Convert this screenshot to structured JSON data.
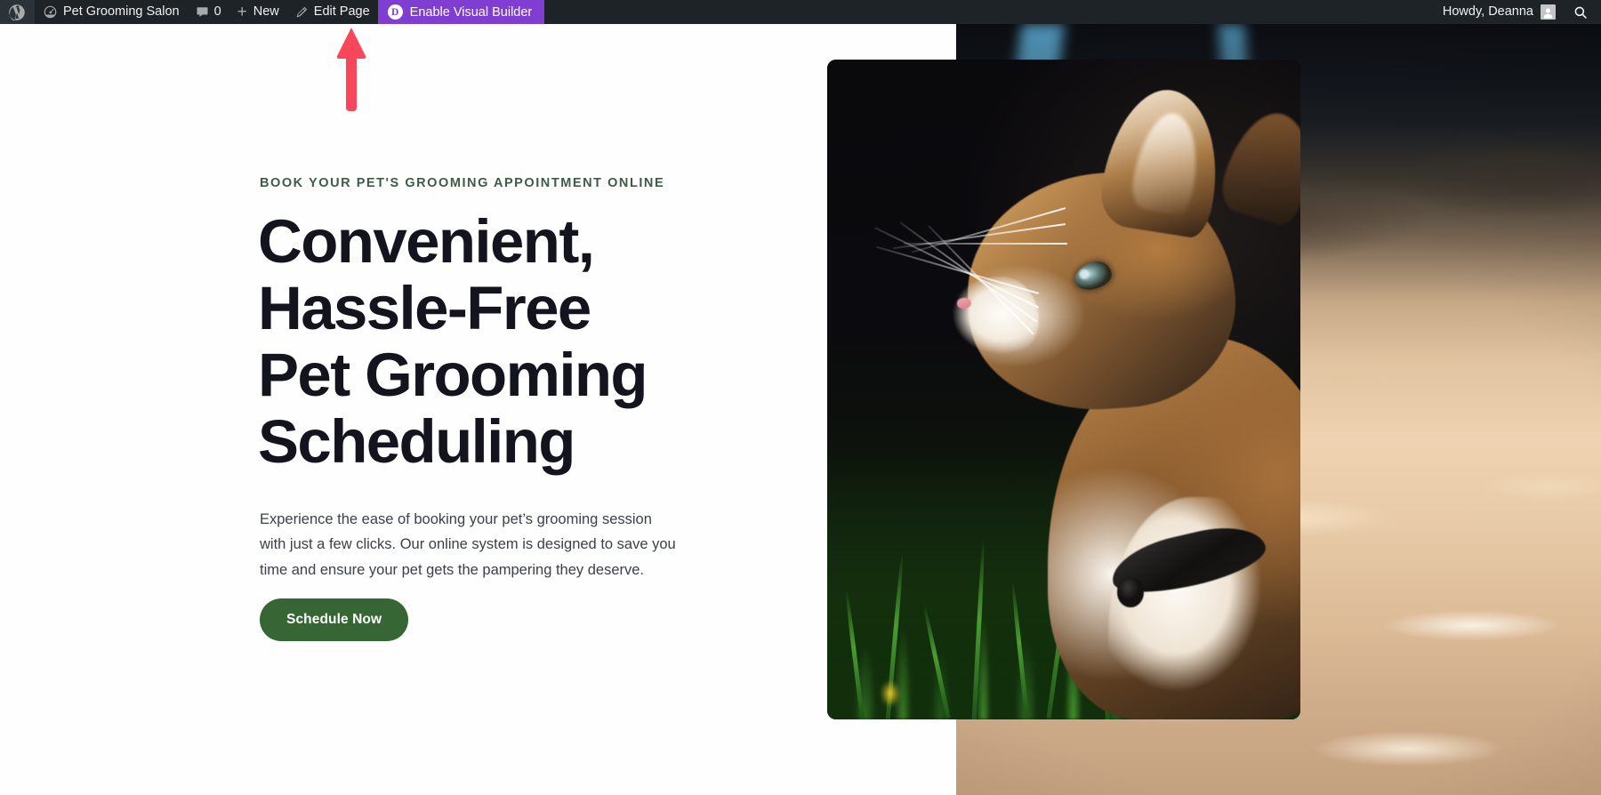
{
  "admin_bar": {
    "wp_logo_icon": "wordpress-logo-icon",
    "site_icon": "dashboard-speedometer-icon",
    "site_name": "Pet Grooming Salon",
    "comments_icon": "comment-bubble-icon",
    "comments_count": "0",
    "new_plus_icon": "plus-icon",
    "new_label": "New",
    "edit_icon": "pencil-icon",
    "edit_label": "Edit Page",
    "divi_badge": "D",
    "divi_label": "Enable Visual Builder",
    "divi_color": "#7f3dd1",
    "howdy_label": "Howdy, Deanna",
    "avatar_icon": "user-avatar-icon",
    "search_icon": "search-icon",
    "bar_color": "#1d2327"
  },
  "hero": {
    "eyebrow": "BOOK YOUR PET'S GROOMING APPOINTMENT ONLINE",
    "eyebrow_color": "#3d5c45",
    "headline": "Convenient, Hassle-Free Pet Grooming Scheduling",
    "headline_color": "#14141f",
    "paragraph": "Experience the ease of booking your pet’s grooming session with just a few clicks. Our online system is designed to save you time and ensure your pet gets the pampering they deserve.",
    "paragraph_color": "#3c4049",
    "cta_label": "Schedule Now",
    "cta_color": "#356634",
    "cta_text_color": "#ffffff",
    "background_color": "#fefefe"
  },
  "media": {
    "foreground_image": "cat-portrait-photo",
    "background_image": "blurred-dry-grass-ground-photo"
  },
  "annotation": {
    "arrow_icon": "up-arrow-annotation-icon",
    "arrow_color": "#f8475a",
    "points_to": "Enable Visual Builder"
  }
}
